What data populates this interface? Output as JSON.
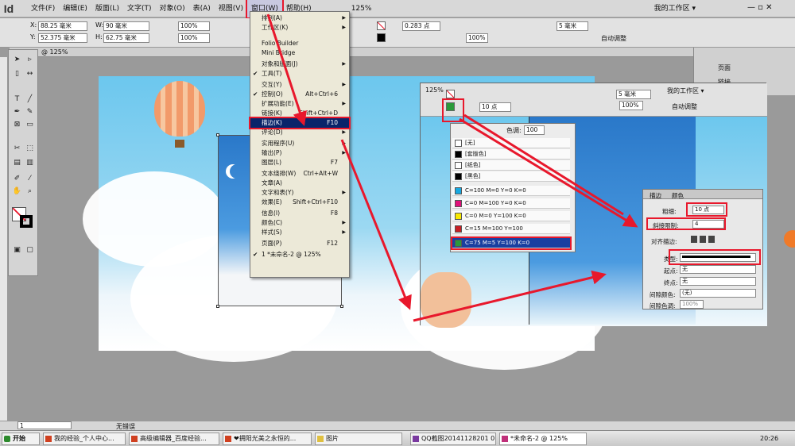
{
  "app": {
    "logo": "Id"
  },
  "menubar": {
    "items": [
      "文件(F)",
      "编辑(E)",
      "版面(L)",
      "文字(T)",
      "对象(O)",
      "表(A)",
      "视图(V)",
      "窗口(W)",
      "帮助(H)"
    ],
    "zoom": "125%",
    "workspace": "我的工作区 ▾"
  },
  "control": {
    "x": "88.25 毫米",
    "y": "52.375 毫米",
    "w": "90 毫米",
    "h": "62.75 毫米",
    "sx": "100%",
    "sy": "100%",
    "stroke_w": "0.283 点",
    "opacity": "100%",
    "pad": "5 毫米",
    "autofit": "自动调整"
  },
  "doc_tab": "@ 125%",
  "window_menu": {
    "items": [
      {
        "label": "排列(A)",
        "arrow": true
      },
      {
        "label": "工作区(K)",
        "arrow": true
      },
      {
        "label": "Folio Builder"
      },
      {
        "label": "Mini Bridge"
      },
      {
        "label": "对象和版面(J)",
        "arrow": true
      },
      {
        "label": "工具(T)",
        "check": true
      },
      {
        "label": "交互(Y)",
        "arrow": true
      },
      {
        "label": "控制(O)",
        "check": true,
        "shortcut": "Alt+Ctrl+6"
      },
      {
        "label": "扩展功能(E)",
        "arrow": true
      },
      {
        "label": "链接(K)",
        "shortcut": "Shift+Ctrl+D"
      },
      {
        "label": "描边(K)",
        "shortcut": "F10",
        "highlight": true
      },
      {
        "label": "评论(D)",
        "arrow": true
      },
      {
        "label": "实用程序(U)",
        "arrow": true
      },
      {
        "label": "输出(P)",
        "arrow": true
      },
      {
        "label": "图层(L)",
        "shortcut": "F7"
      },
      {
        "label": "文本绕排(W)",
        "shortcut": "Ctrl+Alt+W"
      },
      {
        "label": "文章(A)"
      },
      {
        "label": "文字和表(Y)",
        "arrow": true
      },
      {
        "label": "效果(E)",
        "shortcut": "Shift+Ctrl+F10"
      },
      {
        "label": "信息(I)",
        "shortcut": "F8"
      },
      {
        "label": "颜色(C)",
        "arrow": true
      },
      {
        "label": "样式(S)",
        "arrow": true
      },
      {
        "label": "页面(P)",
        "shortcut": "F12"
      },
      {
        "label": "1 *未命名-2 @ 125%",
        "check": true
      }
    ]
  },
  "second_toolbar": {
    "zoom": "125%",
    "workspace": "我的工作区 ▾",
    "stroke": "10 点",
    "pad": "5 毫米",
    "autofit": "自动调整",
    "opacity": "100%"
  },
  "swatches": {
    "tint_label": "色调:",
    "tint_value": "100",
    "items": [
      {
        "label": "[无]",
        "color": "#ffffff"
      },
      {
        "label": "[套版色]",
        "color": "#000000"
      },
      {
        "label": "[纸色]",
        "color": "#ffffff"
      },
      {
        "label": "[黑色]",
        "color": "#000000"
      },
      {
        "label": "C=100 M=0 Y=0 K=0",
        "color": "#18a8e0"
      },
      {
        "label": "C=0 M=100 Y=0 K=0",
        "color": "#e0107a"
      },
      {
        "label": "C=0 M=0 Y=100 K=0",
        "color": "#f8e800"
      },
      {
        "label": "C=15 M=100 Y=100",
        "color": "#c81e24"
      },
      {
        "label": "C=75 M=5 Y=100 K=0",
        "color": "#2a9a3a",
        "selected": true
      }
    ]
  },
  "stroke_panel": {
    "tab1": "描边",
    "tab2": "颜色",
    "weight_label": "粗细:",
    "weight_value": "10 点",
    "miter_label": "斜接限制:",
    "miter_value": "4",
    "align_label": "对齐描边:",
    "type_label": "类型:",
    "start_label": "起点:",
    "start_value": "无",
    "end_label": "终点:",
    "end_value": "无",
    "gap_color_label": "间隙颜色:",
    "gap_color_value": "(无)",
    "gap_tint_label": "间隙色调:",
    "gap_tint_value": "100%"
  },
  "right_panel": {
    "pages": "页面",
    "links": "链接"
  },
  "statusbar": {
    "page": "1",
    "errors": "无错误"
  },
  "taskbar": {
    "start": "开始",
    "tasks": [
      "我的经验_个人中心...",
      "高级编辑器_百度经验...",
      "❤拥阳光美之永恒的...",
      "图片",
      "QQ截图20141128201 0...",
      "*未命名-2 @ 125%"
    ],
    "time": "20:26"
  },
  "colors": {
    "accent_red": "#e8182c",
    "menu_highlight": "#0a246a"
  }
}
